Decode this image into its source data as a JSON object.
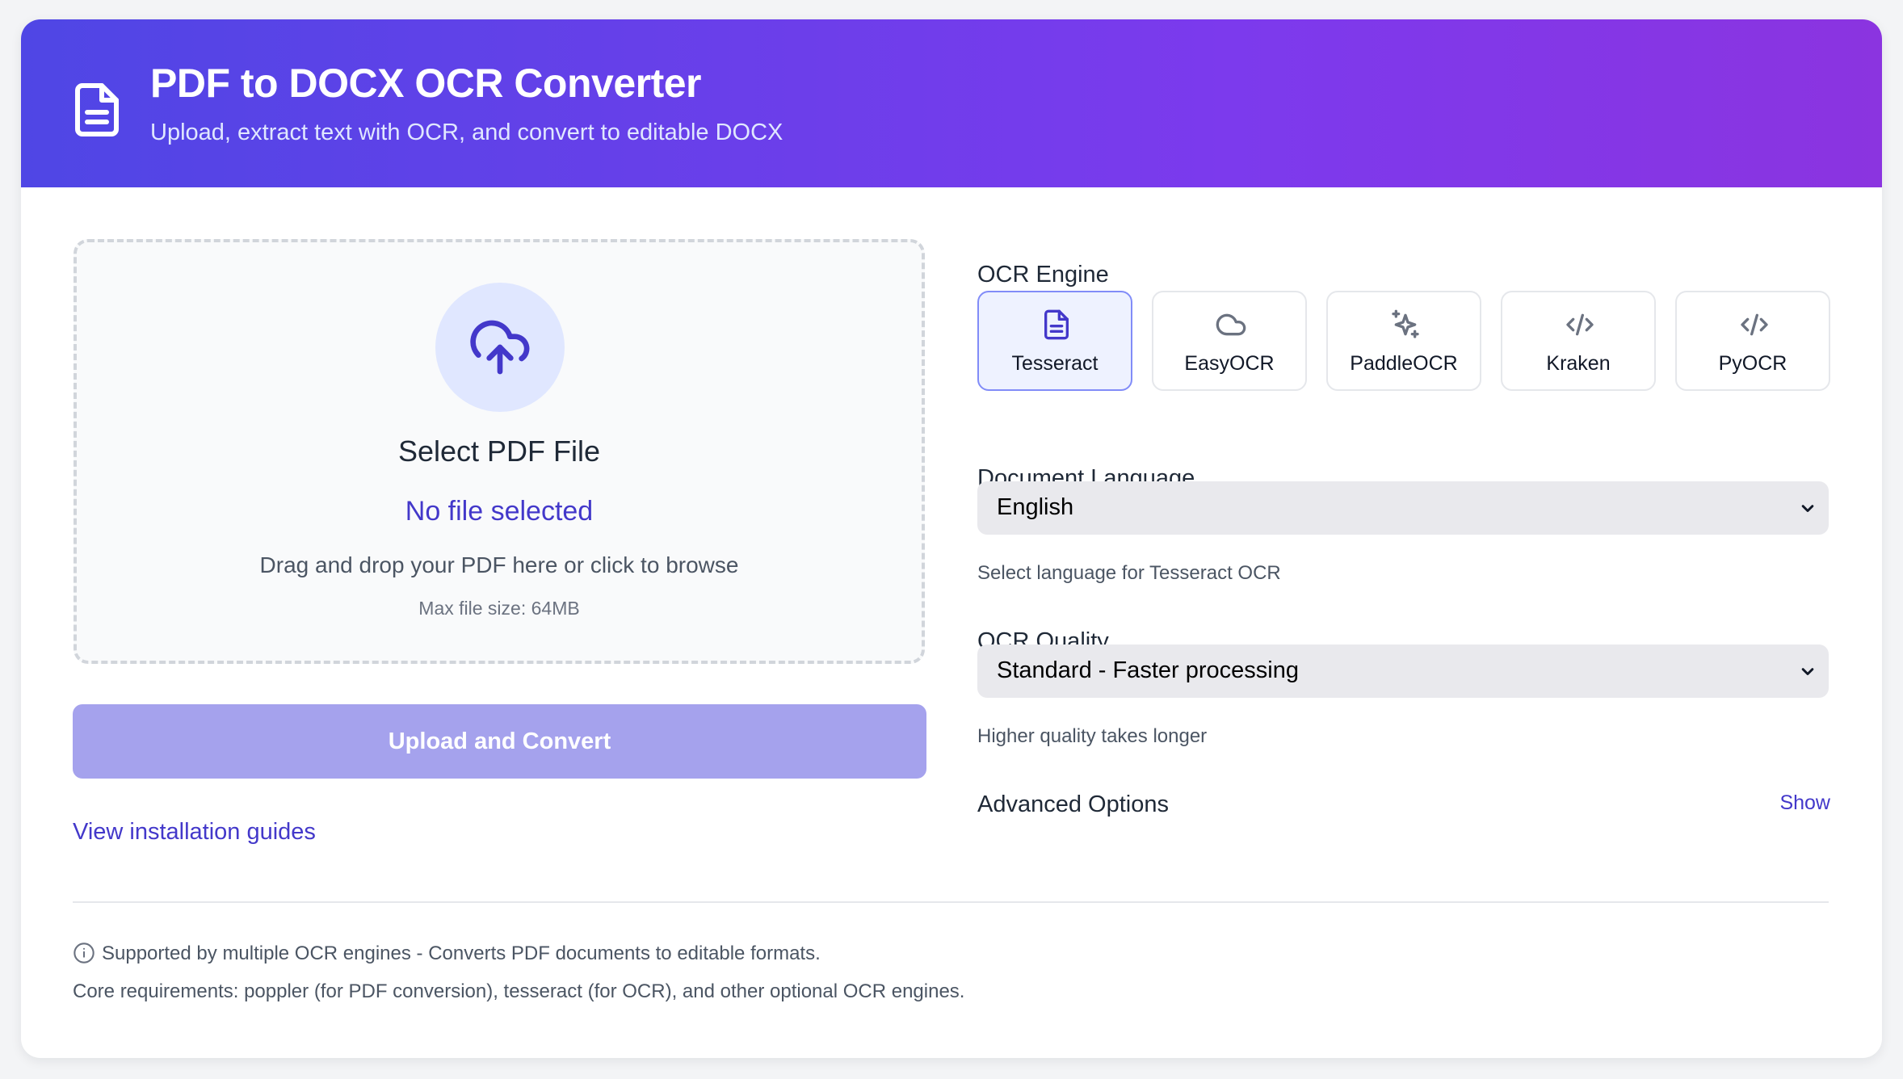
{
  "header": {
    "title": "PDF to DOCX OCR Converter",
    "subtitle": "Upload, extract text with OCR, and convert to editable DOCX",
    "icon": "document-icon"
  },
  "upload": {
    "icon": "cloud-upload-icon",
    "title": "Select PDF File",
    "file_status": "No file selected",
    "hint": "Drag and drop your PDF here or click to browse",
    "max_size": "Max file size: 64MB",
    "button_label": "Upload and Convert",
    "guides_link": "View installation guides"
  },
  "ocr_engine": {
    "label": "OCR Engine",
    "selected": "Tesseract",
    "options": [
      {
        "label": "Tesseract",
        "icon": "document-icon"
      },
      {
        "label": "EasyOCR",
        "icon": "cloud-icon"
      },
      {
        "label": "PaddleOCR",
        "icon": "sparkles-icon"
      },
      {
        "label": "Kraken",
        "icon": "code-icon"
      },
      {
        "label": "PyOCR",
        "icon": "code-icon"
      }
    ]
  },
  "language": {
    "label": "Document Language",
    "value": "English",
    "helper": "Select language for Tesseract OCR"
  },
  "quality": {
    "label": "OCR Quality",
    "value": "Standard - Faster processing",
    "helper": "Higher quality takes longer"
  },
  "advanced": {
    "label": "Advanced Options",
    "toggle": "Show"
  },
  "footer": {
    "line1": "Supported by multiple OCR engines - Converts PDF documents to editable formats.",
    "line2": "Core requirements: poppler (for PDF conversion), tesseract (for OCR), and other optional OCR engines."
  },
  "colors": {
    "accent": "#4338ca",
    "header_gradient_start": "#4f46e5",
    "header_gradient_end": "#8b34e0",
    "button_disabled": "#a5a2ed"
  }
}
